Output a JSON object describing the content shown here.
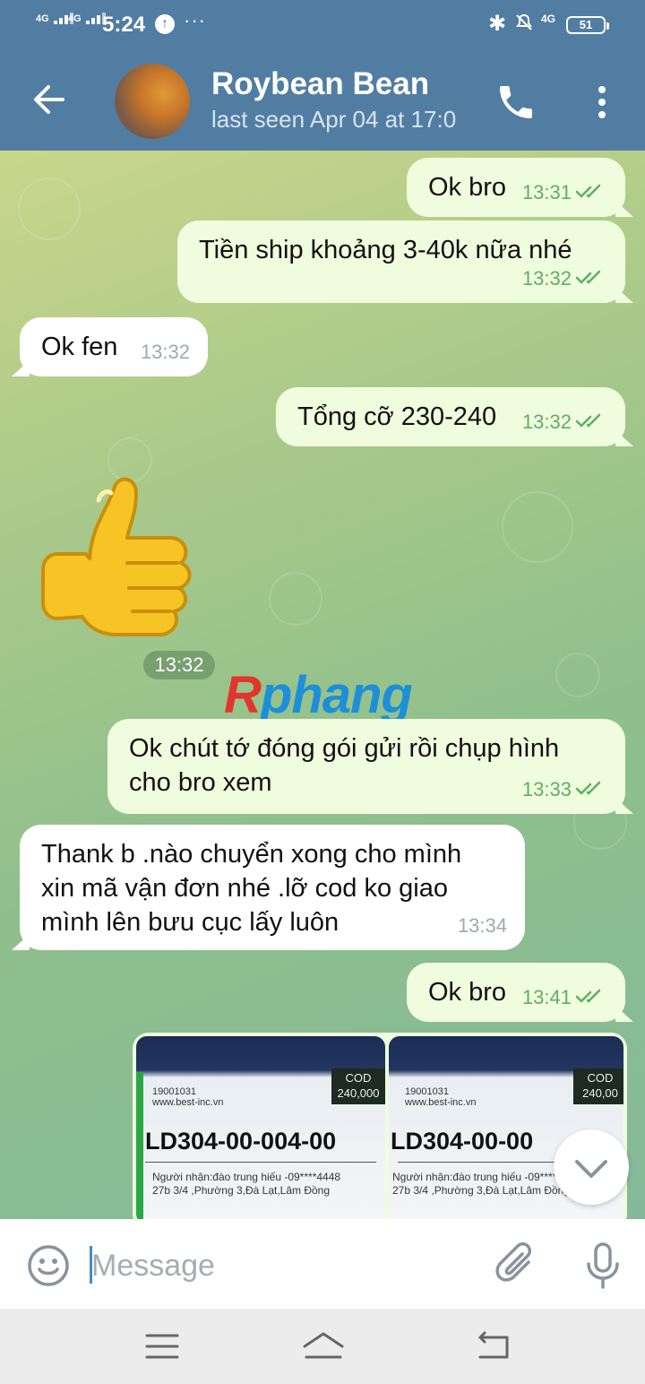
{
  "status_bar": {
    "signal_1": "4G",
    "signal_2": "4G",
    "time": "5:24",
    "upload_glyph": "↑",
    "more_glyph": "···",
    "bluetooth_glyph": "✱",
    "network": "4G",
    "battery": "51"
  },
  "header": {
    "contact_name": "Roybean Bean",
    "last_seen": "last seen Apr 04 at 17:0"
  },
  "messages": [
    {
      "text": "Ok bro",
      "time": "13:31"
    },
    {
      "text": "Tiền ship khoảng 3-40k nữa nhé",
      "time": "13:32"
    },
    {
      "text": "Ok fen",
      "time": "13:32"
    },
    {
      "text": "Tổng cỡ 230-240",
      "time": "13:32"
    },
    {
      "time": "13:32"
    },
    {
      "line1": "Ok chút tớ đóng gói gửi rồi chụp hình",
      "line2": "cho bro xem",
      "time": "13:33"
    },
    {
      "line1": "Thank b .nào chuyển xong cho mình",
      "line2": "xin mã vận đơn nhé .lỡ cod ko giao",
      "line3": "mình lên bưu cục lấy luôn",
      "time": "13:34"
    },
    {
      "text": "Ok bro",
      "time": "13:41"
    }
  ],
  "watermark": {
    "first": "R",
    "rest": "phang"
  },
  "photos": [
    {
      "hotline": "19001031",
      "site": "www.best-inc.vn",
      "cod_label": "COD",
      "cod_value": "240,000",
      "tracking": "LD304-00-004-00",
      "recipient": "Người nhận:đào trung hiếu -09****4448",
      "address": "27b 3/4 ,Phường 3,Đà Lạt,Lâm Đồng"
    },
    {
      "hotline": "19001031",
      "site": "www.best-inc.vn",
      "cod_label": "COD",
      "cod_value": "240,00",
      "tracking": "LD304-00-00",
      "recipient": "Người nhận:đào trung hiếu -09****",
      "address": "27b 3/4 ,Phường 3,Đà Lạt,Lâm Đồng"
    }
  ],
  "input": {
    "placeholder": "Message"
  },
  "icons": {
    "back": "arrow-left-icon",
    "call": "phone-icon",
    "menu": "more-vertical-icon",
    "emoji": "emoji-icon",
    "attach": "paperclip-icon",
    "mic": "microphone-icon",
    "scroll": "chevron-down-icon",
    "read": "double-check-icon"
  },
  "colors": {
    "header": "#527da3",
    "outgoing_bubble": "#effdde",
    "incoming_bubble": "#ffffff",
    "read_check": "#5fae63",
    "accent": "#3e8ed0"
  }
}
